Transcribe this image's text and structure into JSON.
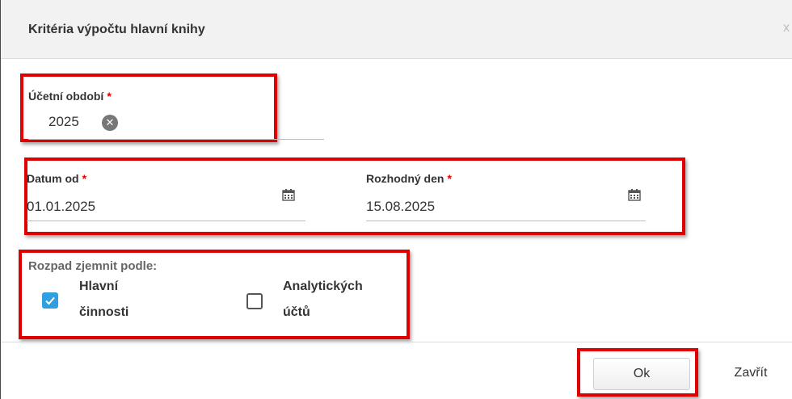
{
  "dialog": {
    "title": "Kritéria výpočtu hlavní knihy",
    "close_glyph": "x"
  },
  "accounting_period": {
    "label": "Účetní období",
    "required_mark": "*",
    "value": "2025",
    "clear_glyph": "✕"
  },
  "date_from": {
    "label": "Datum od",
    "required_mark": "*",
    "value": "01.01.2025",
    "icon": "calendar-icon"
  },
  "decision_day": {
    "label": "Rozhodný den",
    "required_mark": "*",
    "value": "15.08.2025",
    "icon": "calendar-icon"
  },
  "breakdown": {
    "title": "Rozpad zjemnit podle:",
    "options": [
      {
        "label_line1": "Hlavní",
        "label_line2": "činnosti",
        "checked": true
      },
      {
        "label_line1": "Analytických",
        "label_line2": "účtů",
        "checked": false
      }
    ]
  },
  "buttons": {
    "ok": "Ok",
    "close": "Zavřít"
  },
  "colors": {
    "highlight": "#e00000",
    "checkbox_checked": "#2e9fe0",
    "header_bg": "#f2f2f2"
  }
}
